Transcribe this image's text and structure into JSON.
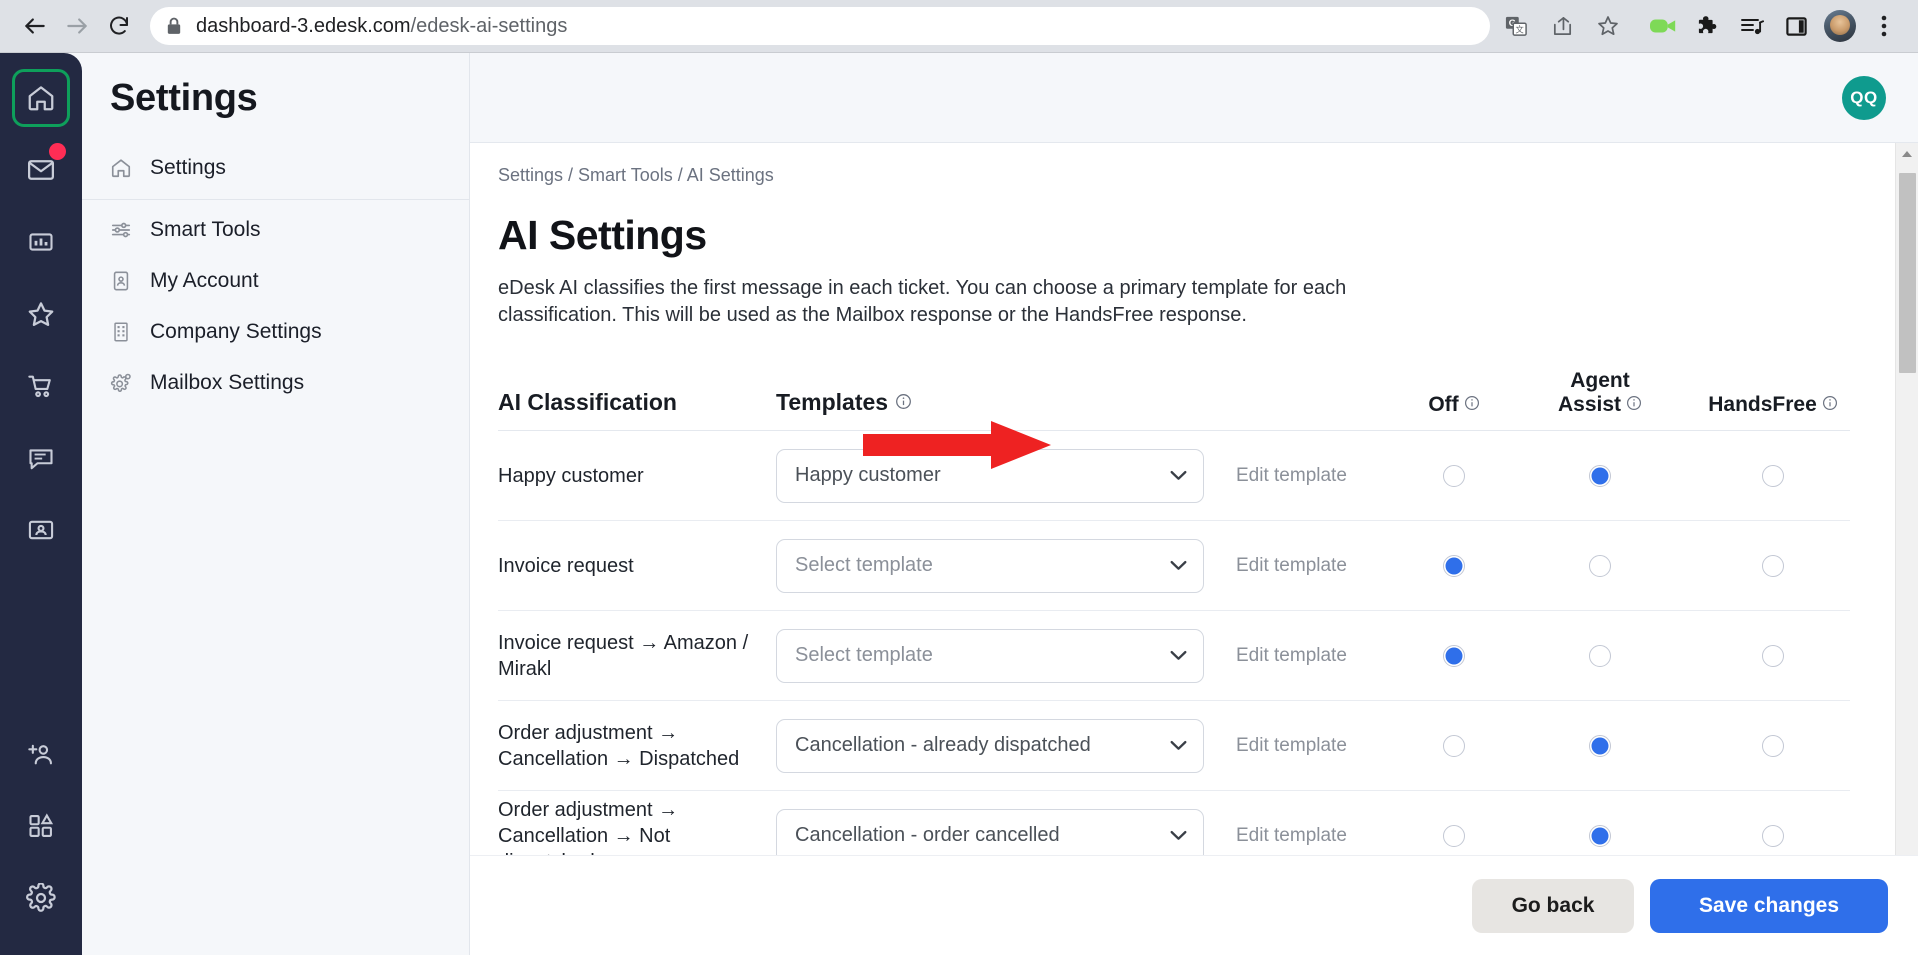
{
  "browser": {
    "back_icon": "back-arrow-icon",
    "forward_icon": "forward-arrow-icon",
    "reload_icon": "reload-icon",
    "lock_icon": "lock-icon",
    "url_host": "dashboard-3.edesk.com",
    "url_path": "/edesk-ai-settings",
    "actions": [
      {
        "name": "translate-icon",
        "title": "Translate"
      },
      {
        "name": "share-icon",
        "title": "Share"
      },
      {
        "name": "bookmark-star-icon",
        "title": "Bookmark"
      }
    ],
    "tools": [
      {
        "name": "video-camera-icon",
        "title": "Record"
      },
      {
        "name": "extensions-puzzle-icon",
        "title": "Extensions"
      },
      {
        "name": "media-playlist-icon",
        "title": "Media"
      },
      {
        "name": "side-panel-icon",
        "title": "Side panel"
      },
      {
        "name": "profile-avatar-icon",
        "title": "Profile"
      },
      {
        "name": "three-dot-menu-icon",
        "title": "Customize and control"
      }
    ]
  },
  "rail": {
    "items": [
      {
        "name": "home-icon",
        "label": "Home",
        "active": true,
        "badge": false
      },
      {
        "name": "mail-icon",
        "label": "Mailbox",
        "active": false,
        "badge": true
      },
      {
        "name": "analytics-chart-icon",
        "label": "Reports",
        "active": false,
        "badge": false
      },
      {
        "name": "star-icon",
        "label": "Favorites",
        "active": false,
        "badge": false
      },
      {
        "name": "shopping-cart-icon",
        "label": "Orders",
        "active": false,
        "badge": false
      },
      {
        "name": "chat-message-icon",
        "label": "Live chat",
        "active": false,
        "badge": false
      },
      {
        "name": "contact-card-icon",
        "label": "Contacts",
        "active": false,
        "badge": false
      }
    ],
    "bottom_items": [
      {
        "name": "add-user-icon",
        "label": "Invite"
      },
      {
        "name": "apps-grid-icon",
        "label": "Apps"
      },
      {
        "name": "settings-gear-icon",
        "label": "Settings"
      }
    ]
  },
  "sidebar": {
    "title": "Settings",
    "items": [
      {
        "label": "Settings",
        "icon": "home-icon"
      },
      {
        "label": "Smart Tools",
        "icon": "sliders-icon"
      },
      {
        "label": "My Account",
        "icon": "id-card-icon"
      },
      {
        "label": "Company Settings",
        "icon": "building-icon"
      },
      {
        "label": "Mailbox Settings",
        "icon": "gear-icon"
      }
    ]
  },
  "header": {
    "avatar_initials": "QQ",
    "avatar_color": "#0f9b8e"
  },
  "main": {
    "breadcrumb": "Settings / Smart Tools / AI Settings",
    "title": "AI Settings",
    "description": "eDesk AI classifies the first message in each ticket. You can choose a primary template for each classification. This will be used as the Mailbox response or the HandsFree response."
  },
  "table": {
    "headers": {
      "classification": "AI Classification",
      "templates": "Templates",
      "off": "Off",
      "agent_assist_line1": "Agent",
      "agent_assist_line2": "Assist",
      "handsfree": "HandsFree"
    },
    "edit_link": "Edit template",
    "rows": [
      {
        "classification": "Happy customer",
        "template": "Happy customer",
        "template_is_placeholder": false,
        "mode": "agent_assist",
        "edit": "Edit template"
      },
      {
        "classification": "Invoice request",
        "template": "Select template",
        "template_is_placeholder": true,
        "mode": "off",
        "edit": "Edit template"
      },
      {
        "classification": "Invoice request → Amazon / Mirakl",
        "template": "Select template",
        "template_is_placeholder": true,
        "mode": "off",
        "edit": "Edit template"
      },
      {
        "classification": "Order adjustment → Cancellation → Dispatched",
        "template": "Cancellation - already dispatched",
        "template_is_placeholder": false,
        "mode": "agent_assist",
        "edit": "Edit template"
      },
      {
        "classification": "Order adjustment → Cancellation → Not dispatched",
        "template": "Cancellation - order cancelled",
        "template_is_placeholder": false,
        "mode": "agent_assist",
        "edit": "Edit template"
      }
    ]
  },
  "footer": {
    "go_back_label": "Go back",
    "save_label": "Save changes",
    "primary_color": "#2f6fea"
  },
  "annotation": {
    "arrow_color": "#ee2222",
    "arrow_name": "red-pointer-arrow"
  }
}
